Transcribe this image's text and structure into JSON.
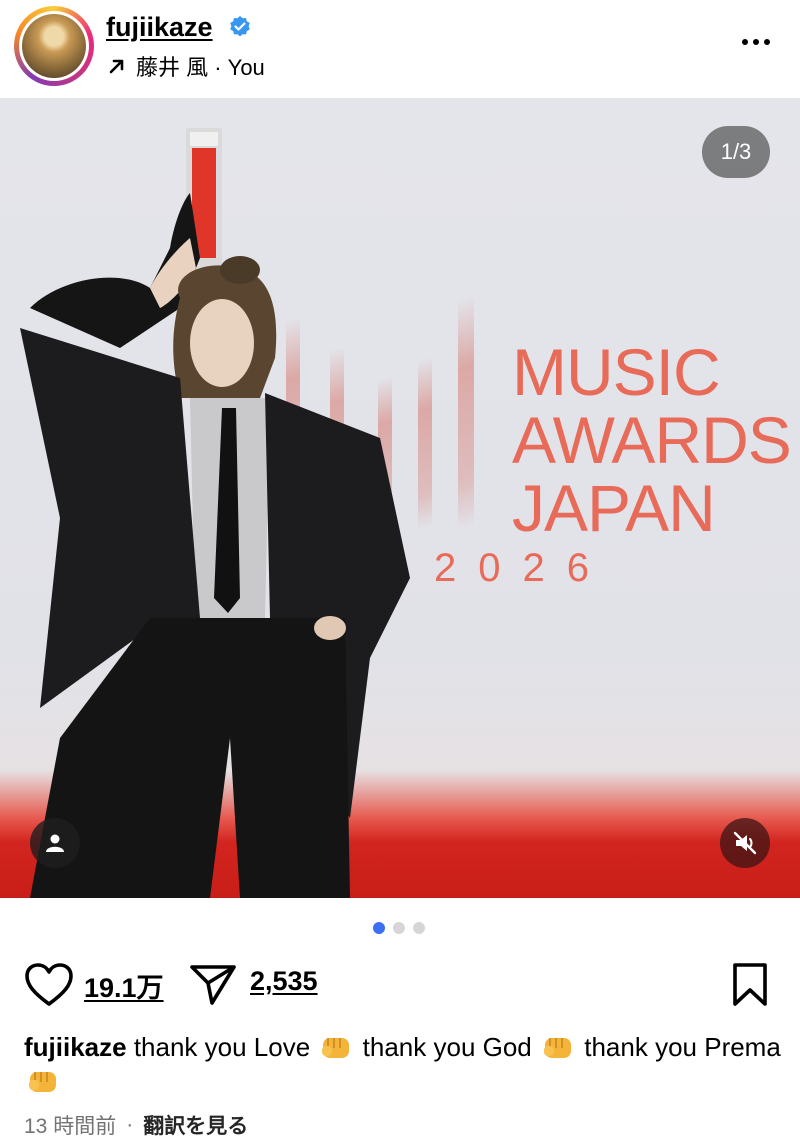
{
  "post": {
    "username": "fujiikaze",
    "verified": true,
    "sub_label": "藤井 風 · You",
    "carousel_counter": "1/3",
    "carousel_total": 3,
    "carousel_index": 1,
    "likes": "19.1万",
    "shares": "2,535",
    "caption": {
      "user": "fujiikaze",
      "parts": [
        "thank you Love",
        "thank you God",
        "thank you Prema"
      ]
    },
    "time_ago": "13 時間前",
    "separator": "·",
    "translate_label": "翻訳を見る"
  },
  "photo": {
    "brand_line1": "MUSIC",
    "brand_line2": "AWARDS",
    "brand_line3": "JAPAN",
    "brand_year": "2026"
  },
  "icons": {
    "verified": "verified-badge-icon",
    "arrow": "arrow-up-right-icon",
    "more": "more-horizontal-icon",
    "tag": "person-tag-icon",
    "mute": "speaker-muted-icon",
    "like": "heart-icon",
    "share": "paper-plane-icon",
    "save": "bookmark-icon",
    "emoji": "fist-emoji-icon"
  },
  "colors": {
    "verified": "#3897f0",
    "dot_active": "#3d6ff2",
    "brand": "#e86a58",
    "carpet": "#c81d18"
  }
}
